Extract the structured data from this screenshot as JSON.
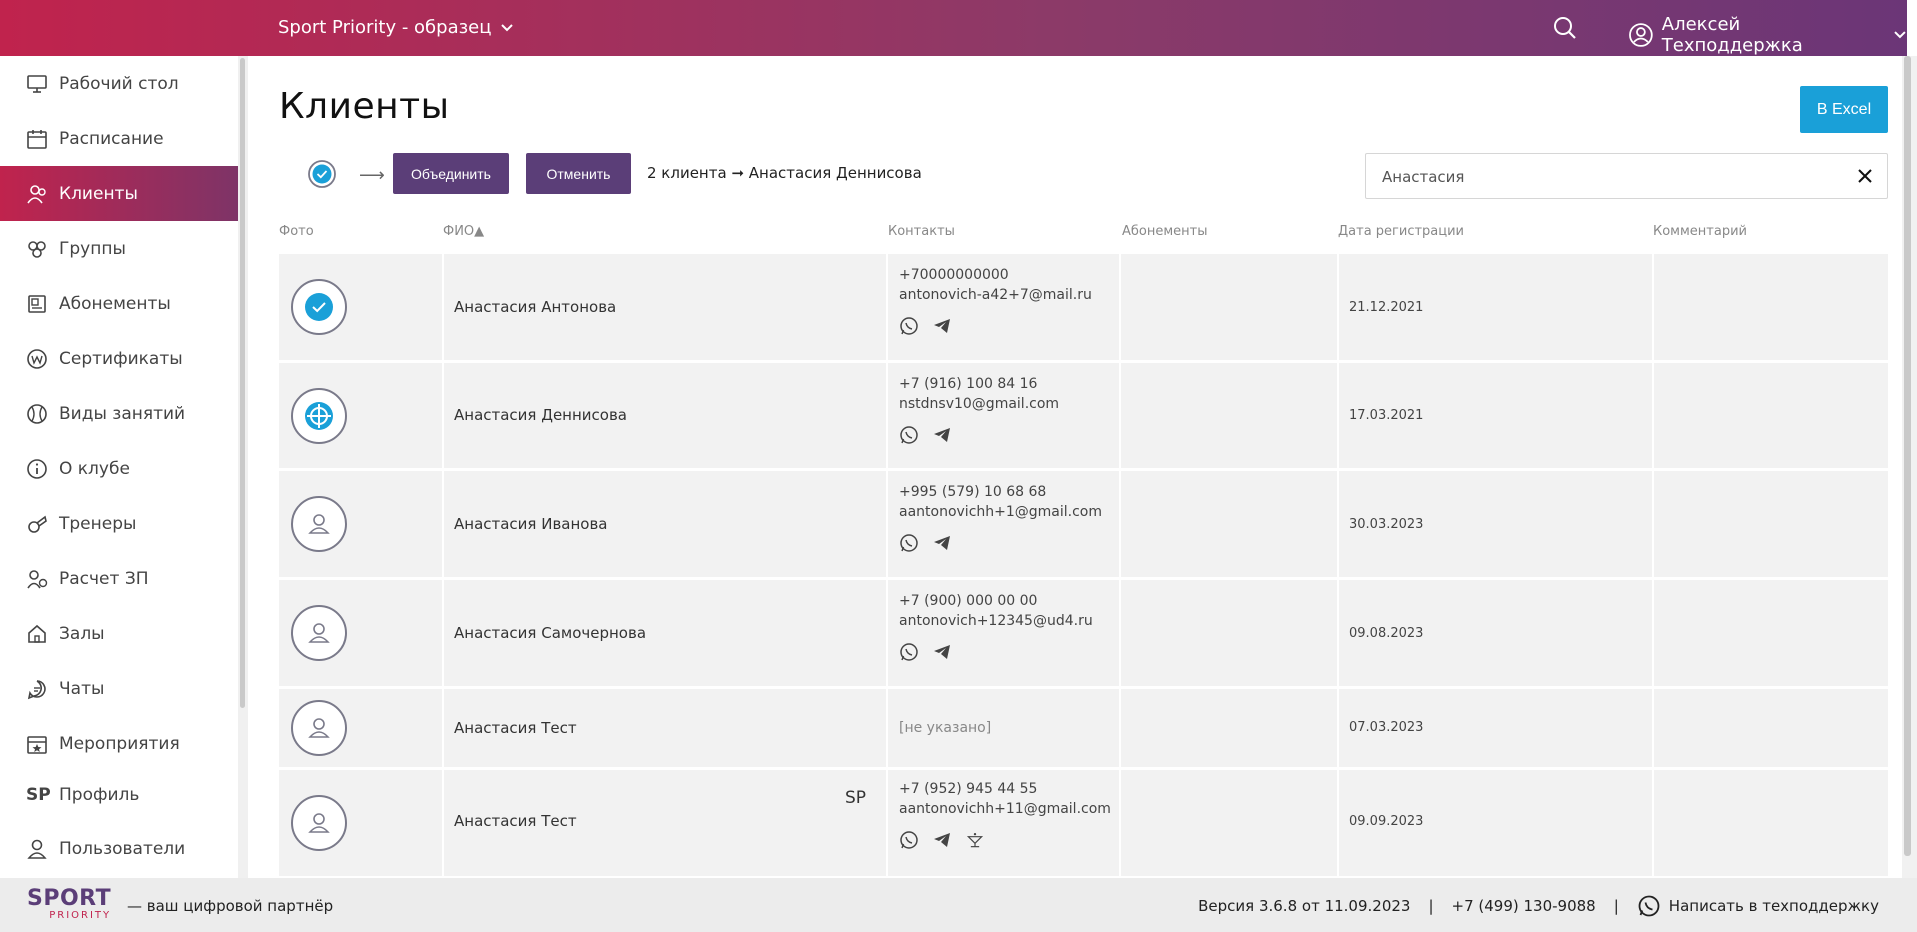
{
  "header": {
    "club_name": "Sport Priority - образец",
    "user_name": "Алексей Техподдержка"
  },
  "sidebar": {
    "items": [
      {
        "label": "Рабочий стол",
        "icon": "monitor-icon"
      },
      {
        "label": "Расписание",
        "icon": "calendar-icon"
      },
      {
        "label": "Клиенты",
        "icon": "clients-icon",
        "active": true
      },
      {
        "label": "Группы",
        "icon": "groups-icon"
      },
      {
        "label": "Абонементы",
        "icon": "membership-icon"
      },
      {
        "label": "Сертификаты",
        "icon": "certificate-icon"
      },
      {
        "label": "Виды занятий",
        "icon": "ball-icon"
      },
      {
        "label": "О клубе",
        "icon": "info-icon"
      },
      {
        "label": "Тренеры",
        "icon": "whistle-icon"
      },
      {
        "label": "Расчет ЗП",
        "icon": "salary-icon"
      },
      {
        "label": "Залы",
        "icon": "home-icon"
      },
      {
        "label": "Чаты",
        "icon": "chat-icon"
      },
      {
        "label": "Мероприятия",
        "icon": "event-icon"
      },
      {
        "label": "Профиль",
        "icon": "sp-profile-icon"
      },
      {
        "label": "Пользователи",
        "icon": "user-icon"
      }
    ]
  },
  "main": {
    "title": "Клиенты",
    "excel_button": "В Excel",
    "merge_button": "Объединить",
    "cancel_button": "Отменить",
    "merge_summary": "2 клиента ➞ Анастасия Деннисова",
    "search_value": "Анастасия"
  },
  "table": {
    "columns": {
      "photo": "Фото",
      "name": "ФИО▲",
      "contacts": "Контакты",
      "memberships": "Абонементы",
      "reg_date": "Дата регистрации",
      "comment": "Комментарий"
    },
    "rows": [
      {
        "name": "Анастасия Антонова",
        "phone": "+70000000000",
        "email": "antonovich-a42+7@mail.ru",
        "date": "21.12.2021",
        "avatar": "checked"
      },
      {
        "name": "Анастасия Деннисова",
        "phone": "+7 (916) 100 84 16",
        "email": "nstdnsv10@gmail.com",
        "date": "17.03.2021",
        "avatar": "target"
      },
      {
        "name": "Анастасия Иванова",
        "phone": "+995 (579) 10 68 68",
        "email": "aantonovichh+1@gmail.com",
        "date": "30.03.2023",
        "avatar": "person"
      },
      {
        "name": "Анастасия Самочернова",
        "phone": "+7 (900) 000 00 00",
        "email": "antonovich+12345@ud4.ru",
        "date": "09.08.2023",
        "avatar": "person"
      },
      {
        "name": "Анастасия Тест",
        "unknown": "[не указано]",
        "date": "07.03.2023",
        "avatar": "person"
      },
      {
        "name": "Анастасия Тест",
        "phone": "+7 (952) 945 44 55",
        "email": "aantonovichh+11@gmail.com",
        "date": "09.09.2023",
        "avatar": "person",
        "badge": "SP"
      }
    ]
  },
  "footer": {
    "logo_top": "SPORT",
    "logo_bottom": "PRIORITY",
    "tagline": "— ваш цифровой партнёр",
    "version": "Версия 3.6.8 от 11.09.2023",
    "sep": "|",
    "phone": "+7 (499) 130-9088",
    "support": "Написать в техподдержку"
  },
  "colors": {
    "accent_red": "#c0234d",
    "accent_purple": "#5b3e78",
    "excel_blue": "#1aa0d8",
    "check_blue": "#1aa0d8"
  }
}
